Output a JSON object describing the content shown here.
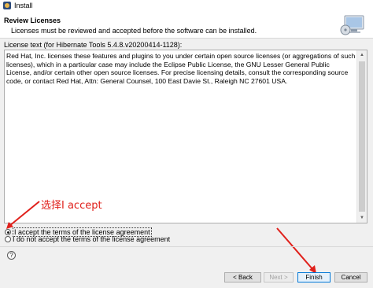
{
  "window": {
    "title": "Install"
  },
  "header": {
    "title": "Review Licenses",
    "description": "Licenses must be reviewed and accepted before the software can be installed."
  },
  "license": {
    "label": "License text (for Hibernate Tools 5.4.8.v20200414-1128):",
    "text": "Red Hat, Inc. licenses these features and plugins to you under certain open source licenses (or aggregations of such licenses), which in a particular case may include the Eclipse Public License, the GNU Lesser General Public License, and/or certain other open source licenses. For precise licensing details, consult the corresponding source code, or contact Red Hat, Attn: General Counsel, 100 East Davie St., Raleigh NC 27601 USA."
  },
  "annotation": {
    "text": "选择I accept",
    "color": "#e0201b"
  },
  "options": {
    "accept_label": "I accept the terms of the license agreement",
    "decline_label": "I do not accept the terms of the license agreement",
    "selected": "accept"
  },
  "buttons": {
    "help_label": "?",
    "back_label": "< Back",
    "next_label": "Next >",
    "finish_label": "Finish",
    "cancel_label": "Cancel"
  },
  "icons": [
    "install-icon",
    "install-wizard-graphic",
    "help-icon",
    "scroll-up-icon",
    "scroll-down-icon"
  ]
}
